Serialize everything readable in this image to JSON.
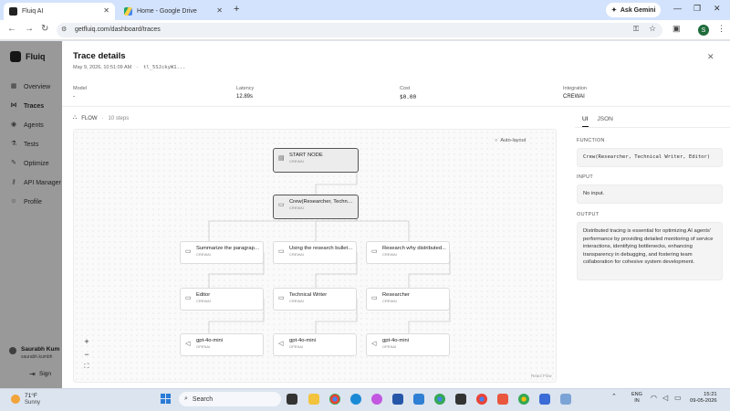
{
  "browser": {
    "tabs": [
      {
        "title": "Fluiq AI",
        "active": true
      },
      {
        "title": "Home - Google Drive",
        "active": false
      }
    ],
    "new_tab": "+",
    "ask_gemini": "Ask Gemini",
    "url": "getfluiq.com/dashboard/traces",
    "profile_initial": "S"
  },
  "app": {
    "logo": "Fluiq",
    "nav": [
      {
        "label": "Overview",
        "icon": "grid-icon"
      },
      {
        "label": "Traces",
        "icon": "trace-icon",
        "active": true
      },
      {
        "label": "Agents",
        "icon": "agent-icon"
      },
      {
        "label": "Tests",
        "icon": "test-icon"
      },
      {
        "label": "Optimize",
        "icon": "optimize-icon"
      },
      {
        "label": "API Manager",
        "icon": "key-icon"
      },
      {
        "label": "Profile",
        "icon": "user-icon"
      }
    ],
    "user": {
      "name": "Saurabh Kum",
      "email": "saurabh.kumbh",
      "signout": "Sign"
    }
  },
  "drawer": {
    "title": "Trace details",
    "timestamp": "May 9, 2026, 10:51:09 AM",
    "trace_id": "tl_5SJckyW1...",
    "meta": {
      "model_label": "Model",
      "model_value": "-",
      "latency_label": "Latency",
      "latency_value": "12.89s",
      "cost_label": "Cost",
      "cost_value": "$0.00",
      "integration_label": "Integration",
      "integration_value": "CREWAI"
    },
    "flow_label": "FLOW",
    "steps": "10 steps",
    "auto_layout": "Auto-layout",
    "react_flow": "React Flow",
    "zoom_in": "+",
    "zoom_out": "−",
    "fit": "⛶",
    "nodes": [
      {
        "title": "START NODE",
        "tag": "CREWAI",
        "highlight": true
      },
      {
        "title": "Crew(Researcher, Technical Writer, Editor)",
        "tag": "CREWAI",
        "highlight": true
      },
      {
        "title": "Summarize the paragraph...",
        "tag": "CREWAI"
      },
      {
        "title": "Using the research bullet ...",
        "tag": "CREWAI"
      },
      {
        "title": "Research why distributed...",
        "tag": "CREWAI"
      },
      {
        "title": "Editor",
        "tag": "CREWAI"
      },
      {
        "title": "Technical Writer",
        "tag": "CREWAI"
      },
      {
        "title": "Researcher",
        "tag": "CREWAI"
      },
      {
        "title": "gpt-4o-mini",
        "tag": "OPENAI"
      },
      {
        "title": "gpt-4o-mini",
        "tag": "OPENAI"
      },
      {
        "title": "gpt-4o-mini",
        "tag": "OPENAI"
      }
    ],
    "panel": {
      "tabs": [
        "UI",
        "JSON"
      ],
      "function_label": "FUNCTION",
      "function_value": "Crew(Researcher, Technical Writer, Editor)",
      "input_label": "INPUT",
      "input_value": "No input.",
      "output_label": "OUTPUT",
      "output_value": "Distributed tracing is essential for optimizing AI agents' performance by providing detailed monitoring of service interactions, identifying bottlenecks, enhancing transparency in debugging, and fostering team collaboration for cohesive system development."
    }
  },
  "taskbar": {
    "temp": "71°F",
    "condition": "Sunny",
    "search": "Search",
    "lang1": "ENG",
    "lang2": "IN",
    "time": "15:21",
    "date": "09-05-2026"
  },
  "colors": {
    "tab_strip": "#d3e3fd",
    "accent": "#1a73e8",
    "node_highlight_border": "#555555"
  }
}
